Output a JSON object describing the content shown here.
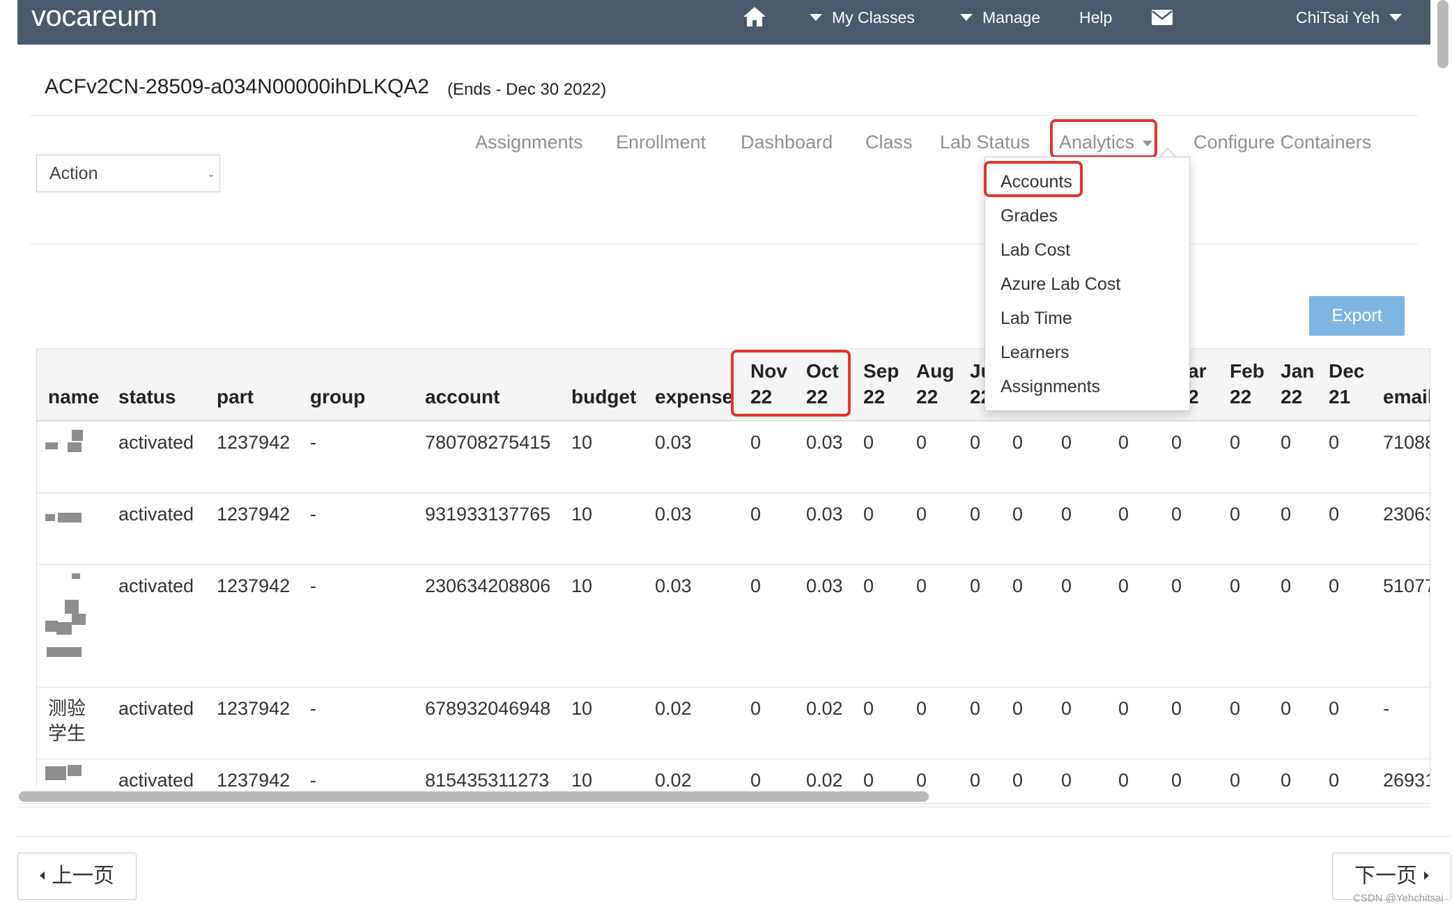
{
  "navbar": {
    "brand": "vocareum",
    "my_classes": "My Classes",
    "manage": "Manage",
    "help": "Help",
    "user": "ChiTsai Yeh",
    "home_icon": "home-icon",
    "mail_icon": "envelope-icon",
    "color": "#4a5a6c"
  },
  "header": {
    "class_name": "ACFv2CN-28509-a034N00000ihDLKQA2",
    "ends": "(Ends - Dec 30 2022)"
  },
  "tabs": {
    "assignments": "Assignments",
    "enrollment": "Enrollment",
    "dashboard": "Dashboard",
    "class": "Class",
    "lab_status": "Lab Status",
    "analytics": "Analytics",
    "configure_containers": "Configure Containers"
  },
  "action_select": {
    "value": "Action"
  },
  "export_label": "Export",
  "analytics_menu": {
    "accounts": "Accounts",
    "grades": "Grades",
    "lab_cost": "Lab Cost",
    "azure_lab_cost": "Azure Lab Cost",
    "lab_time": "Lab Time",
    "learners": "Learners",
    "assignments": "Assignments"
  },
  "table": {
    "headers": {
      "name": "name",
      "status": "status",
      "part": "part",
      "group": "group",
      "account": "account",
      "budget": "budget",
      "expense": "expense",
      "nov1": "Nov",
      "nov2": "22",
      "oct1": "Oct",
      "oct2": "22",
      "sep1": "Sep",
      "sep2": "22",
      "aug1": "Aug",
      "aug2": "22",
      "jul1": "Ju",
      "jul2": "22",
      "mar1": "ar",
      "mar2": "2",
      "feb1": "Feb",
      "feb2": "22",
      "jan1": "Jan",
      "jan2": "22",
      "dec1": "Dec",
      "dec2": "21",
      "email": "email"
    },
    "rows": [
      {
        "name": "",
        "status": "activated",
        "part": "1237942",
        "group": "-",
        "account": "780708275415",
        "budget": "10",
        "expense": "0.03",
        "m": [
          "0",
          "0.03",
          "0",
          "0",
          "0",
          "0",
          "0",
          "0",
          "0",
          "0",
          "0",
          "0"
        ],
        "email": "71088"
      },
      {
        "name": "",
        "status": "activated",
        "part": "1237942",
        "group": "-",
        "account": "931933137765",
        "budget": "10",
        "expense": "0.03",
        "m": [
          "0",
          "0.03",
          "0",
          "0",
          "0",
          "0",
          "0",
          "0",
          "0",
          "0",
          "0",
          "0"
        ],
        "email": "23063"
      },
      {
        "name": "",
        "status": "activated",
        "part": "1237942",
        "group": "-",
        "account": "230634208806",
        "budget": "10",
        "expense": "0.03",
        "m": [
          "0",
          "0.03",
          "0",
          "0",
          "0",
          "0",
          "0",
          "0",
          "0",
          "0",
          "0",
          "0"
        ],
        "email": "51077"
      },
      {
        "name_line1": "测验",
        "name_line2": "学生",
        "status": "activated",
        "part": "1237942",
        "group": "-",
        "account": "678932046948",
        "budget": "10",
        "expense": "0.02",
        "m": [
          "0",
          "0.02",
          "0",
          "0",
          "0",
          "0",
          "0",
          "0",
          "0",
          "0",
          "0",
          "0"
        ],
        "email": "-"
      },
      {
        "name": "",
        "status": "activated",
        "part": "1237942",
        "group": "-",
        "account": "815435311273",
        "budget": "10",
        "expense": "0.02",
        "m": [
          "0",
          "0.02",
          "0",
          "0",
          "0",
          "0",
          "0",
          "0",
          "0",
          "0",
          "0",
          "0"
        ],
        "email": "26931"
      }
    ]
  },
  "pager": {
    "prev": "上一页",
    "next": "下一页"
  },
  "watermark": "CSDN @Yehchitsai",
  "highlight_color": "#e0372a"
}
